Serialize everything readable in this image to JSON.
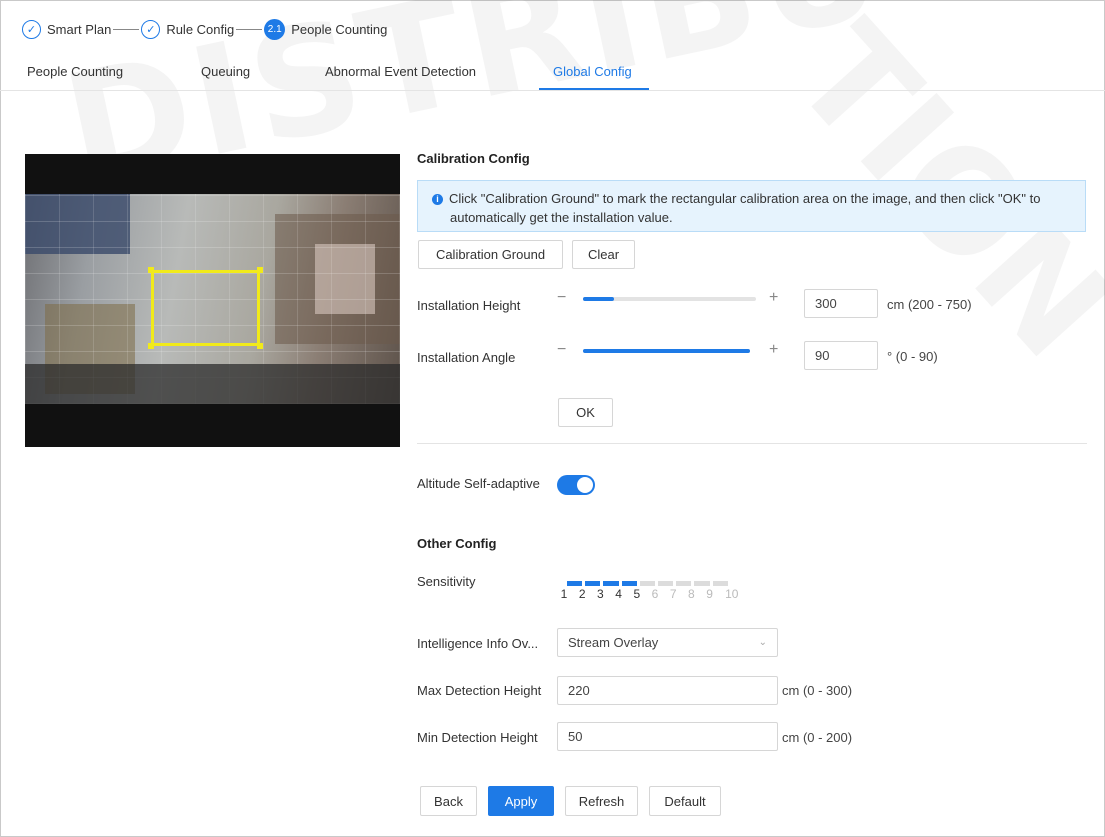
{
  "steps": [
    {
      "label": "Smart Plan",
      "state": "done"
    },
    {
      "label": "Rule Config",
      "state": "done"
    },
    {
      "label": "People Counting",
      "state": "current",
      "number": "2.1"
    }
  ],
  "tabs": [
    {
      "label": "People Counting"
    },
    {
      "label": "Queuing"
    },
    {
      "label": "Abnormal Event Detection"
    },
    {
      "label": "Global Config",
      "active": true
    }
  ],
  "calibration": {
    "title": "Calibration Config",
    "info_line1": "Click \"Calibration Ground\" to mark the rectangular calibration area on the image, and then click \"OK\" to",
    "info_line2": "automatically get the installation value.",
    "calibration_ground_btn": "Calibration Ground",
    "clear_btn": "Clear",
    "height_label": "Installation Height",
    "height_value": "300",
    "height_range": "cm  (200 - 750)",
    "height_fill_fraction": 0.18,
    "angle_label": "Installation Angle",
    "angle_value": "90",
    "angle_range": "°  (0 - 90)",
    "angle_fill_fraction": 1.0,
    "minus": "−",
    "plus": "+",
    "ok_btn": "OK"
  },
  "altitude": {
    "label": "Altitude Self-adaptive",
    "enabled": true
  },
  "other": {
    "title": "Other Config",
    "sensitivity_label": "Sensitivity",
    "sensitivity_value": 5,
    "sensitivity_ticks": [
      "1",
      "2",
      "3",
      "4",
      "5",
      "6",
      "7",
      "8",
      "9",
      "10"
    ],
    "overlay_label": "Intelligence Info Ov...",
    "overlay_value": "Stream Overlay",
    "max_label": "Max Detection Height",
    "max_value": "220",
    "max_range": "cm  (0 - 300)",
    "min_label": "Min Detection Height",
    "min_value": "50",
    "min_range": "cm  (0 - 200)"
  },
  "footer": {
    "back": "Back",
    "apply": "Apply",
    "refresh": "Refresh",
    "default": "Default"
  },
  "colors": {
    "accent": "#1e7ae6",
    "calibration_box": "#f1ea1a"
  }
}
